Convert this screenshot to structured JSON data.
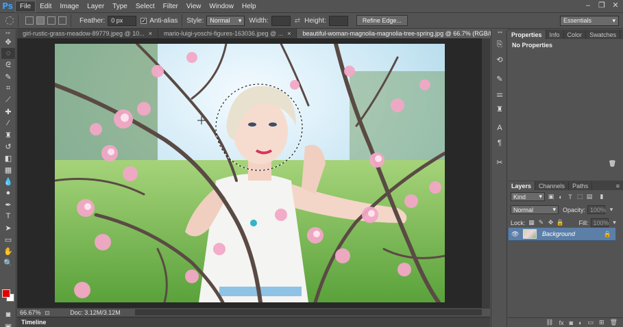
{
  "app": {
    "logo": "Ps"
  },
  "menu": [
    "File",
    "Edit",
    "Image",
    "Layer",
    "Type",
    "Select",
    "Filter",
    "View",
    "Window",
    "Help"
  ],
  "window_controls": [
    "–",
    "❐",
    "✕"
  ],
  "options": {
    "feather_label": "Feather:",
    "feather_value": "0 px",
    "antialias_label": "Anti-alias",
    "style_label": "Style:",
    "style_value": "Normal",
    "width_label": "Width:",
    "height_label": "Height:",
    "refine_edge": "Refine Edge...",
    "workspace": "Essentials"
  },
  "tabs": [
    {
      "label": "girl-rustic-grass-meadow-89779.jpeg @ 10..."
    },
    {
      "label": "mario-luigi-yoschi-figures-163036.jpeg @ ..."
    },
    {
      "label": "beautiful-woman-magnolia-magnolia-tree-spring.jpg @ 66.7% (RGB/8)"
    }
  ],
  "status": {
    "zoom": "66.67%",
    "doc": "Doc: 3.12M/3.12M"
  },
  "timeline_label": "Timeline",
  "properties_panel": {
    "tabs": [
      "Properties",
      "Info",
      "Color",
      "Swatches"
    ],
    "body": "No Properties"
  },
  "layers_panel": {
    "tabs": [
      "Layers",
      "Channels",
      "Paths"
    ],
    "kind_label": "Kind",
    "blend_mode": "Normal",
    "opacity_label": "Opacity:",
    "opacity_value": "100%",
    "lock_label": "Lock:",
    "fill_label": "Fill:",
    "fill_value": "100%",
    "layer_name": "Background"
  },
  "colors": {
    "foreground": "#e10000",
    "background": "#ffffff",
    "accent": "#5c7fa8"
  }
}
